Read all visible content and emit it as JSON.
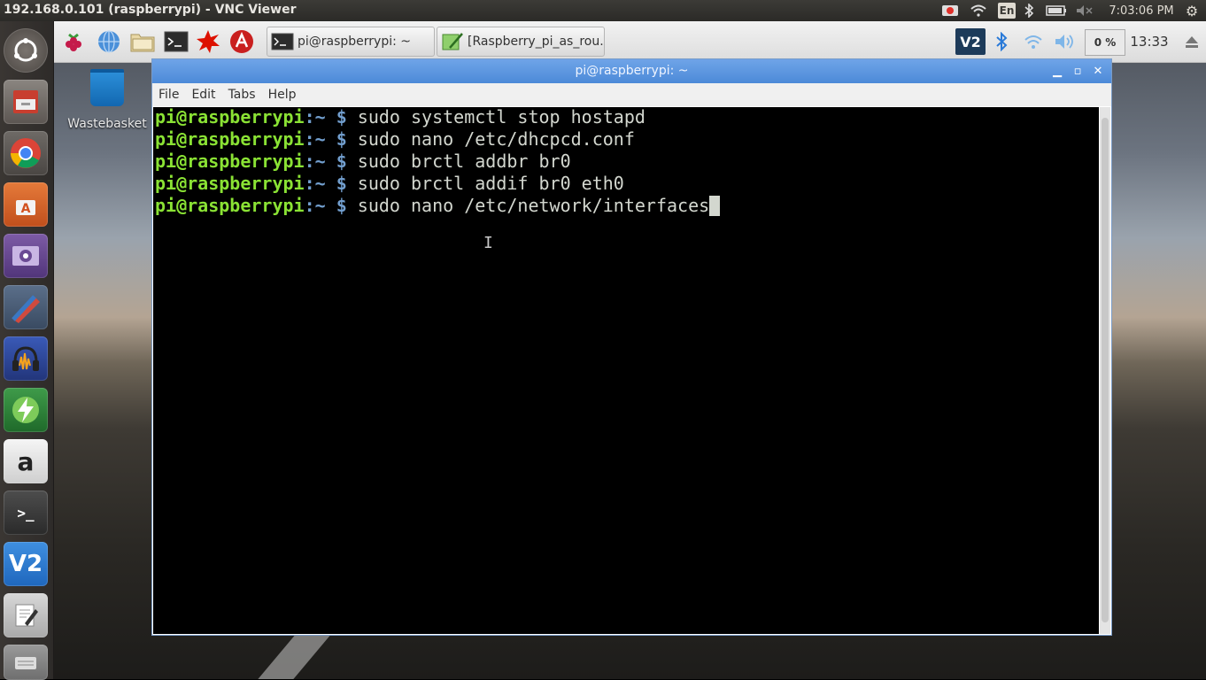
{
  "vnc": {
    "title": "192.168.0.101 (raspberrypi) - VNC Viewer",
    "lang": "En",
    "clock": "7:03:06 PM"
  },
  "launcher": {
    "items": [
      {
        "name": "ubuntu-dash-icon"
      },
      {
        "name": "files-icon"
      },
      {
        "name": "chrome-icon"
      },
      {
        "name": "software-center-icon"
      },
      {
        "name": "video-player-icon"
      },
      {
        "name": "pen-tool-icon"
      },
      {
        "name": "audacity-icon"
      },
      {
        "name": "thunder-app-icon"
      },
      {
        "name": "amazon-icon",
        "glyph": "a"
      },
      {
        "name": "terminal-icon",
        "glyph": ">_"
      },
      {
        "name": "vnc-viewer-icon",
        "glyph": "V2"
      },
      {
        "name": "text-editor-icon"
      },
      {
        "name": "drive-icon"
      }
    ]
  },
  "pi_panel": {
    "tasks": [
      {
        "label": "pi@raspberrypi: ~"
      },
      {
        "label": "[Raspberry_pi_as_rou..."
      }
    ],
    "cpu": "0 %",
    "clock": "13:33"
  },
  "desktop": {
    "wastebasket": "Wastebasket"
  },
  "terminal": {
    "title": "pi@raspberrypi: ~",
    "menu": [
      "File",
      "Edit",
      "Tabs",
      "Help"
    ],
    "prompt_user": "pi@raspberrypi",
    "prompt_path": ":~ $",
    "commands": [
      "sudo systemctl stop hostapd",
      "sudo nano /etc/dhcpcd.conf",
      "sudo brctl addbr br0",
      "sudo brctl addif br0 eth0",
      "sudo nano /etc/network/interfaces"
    ]
  },
  "colors": {
    "prompt_user": "#8ae234",
    "prompt_path": "#729fcf",
    "titlebar": "#5b96e0"
  }
}
